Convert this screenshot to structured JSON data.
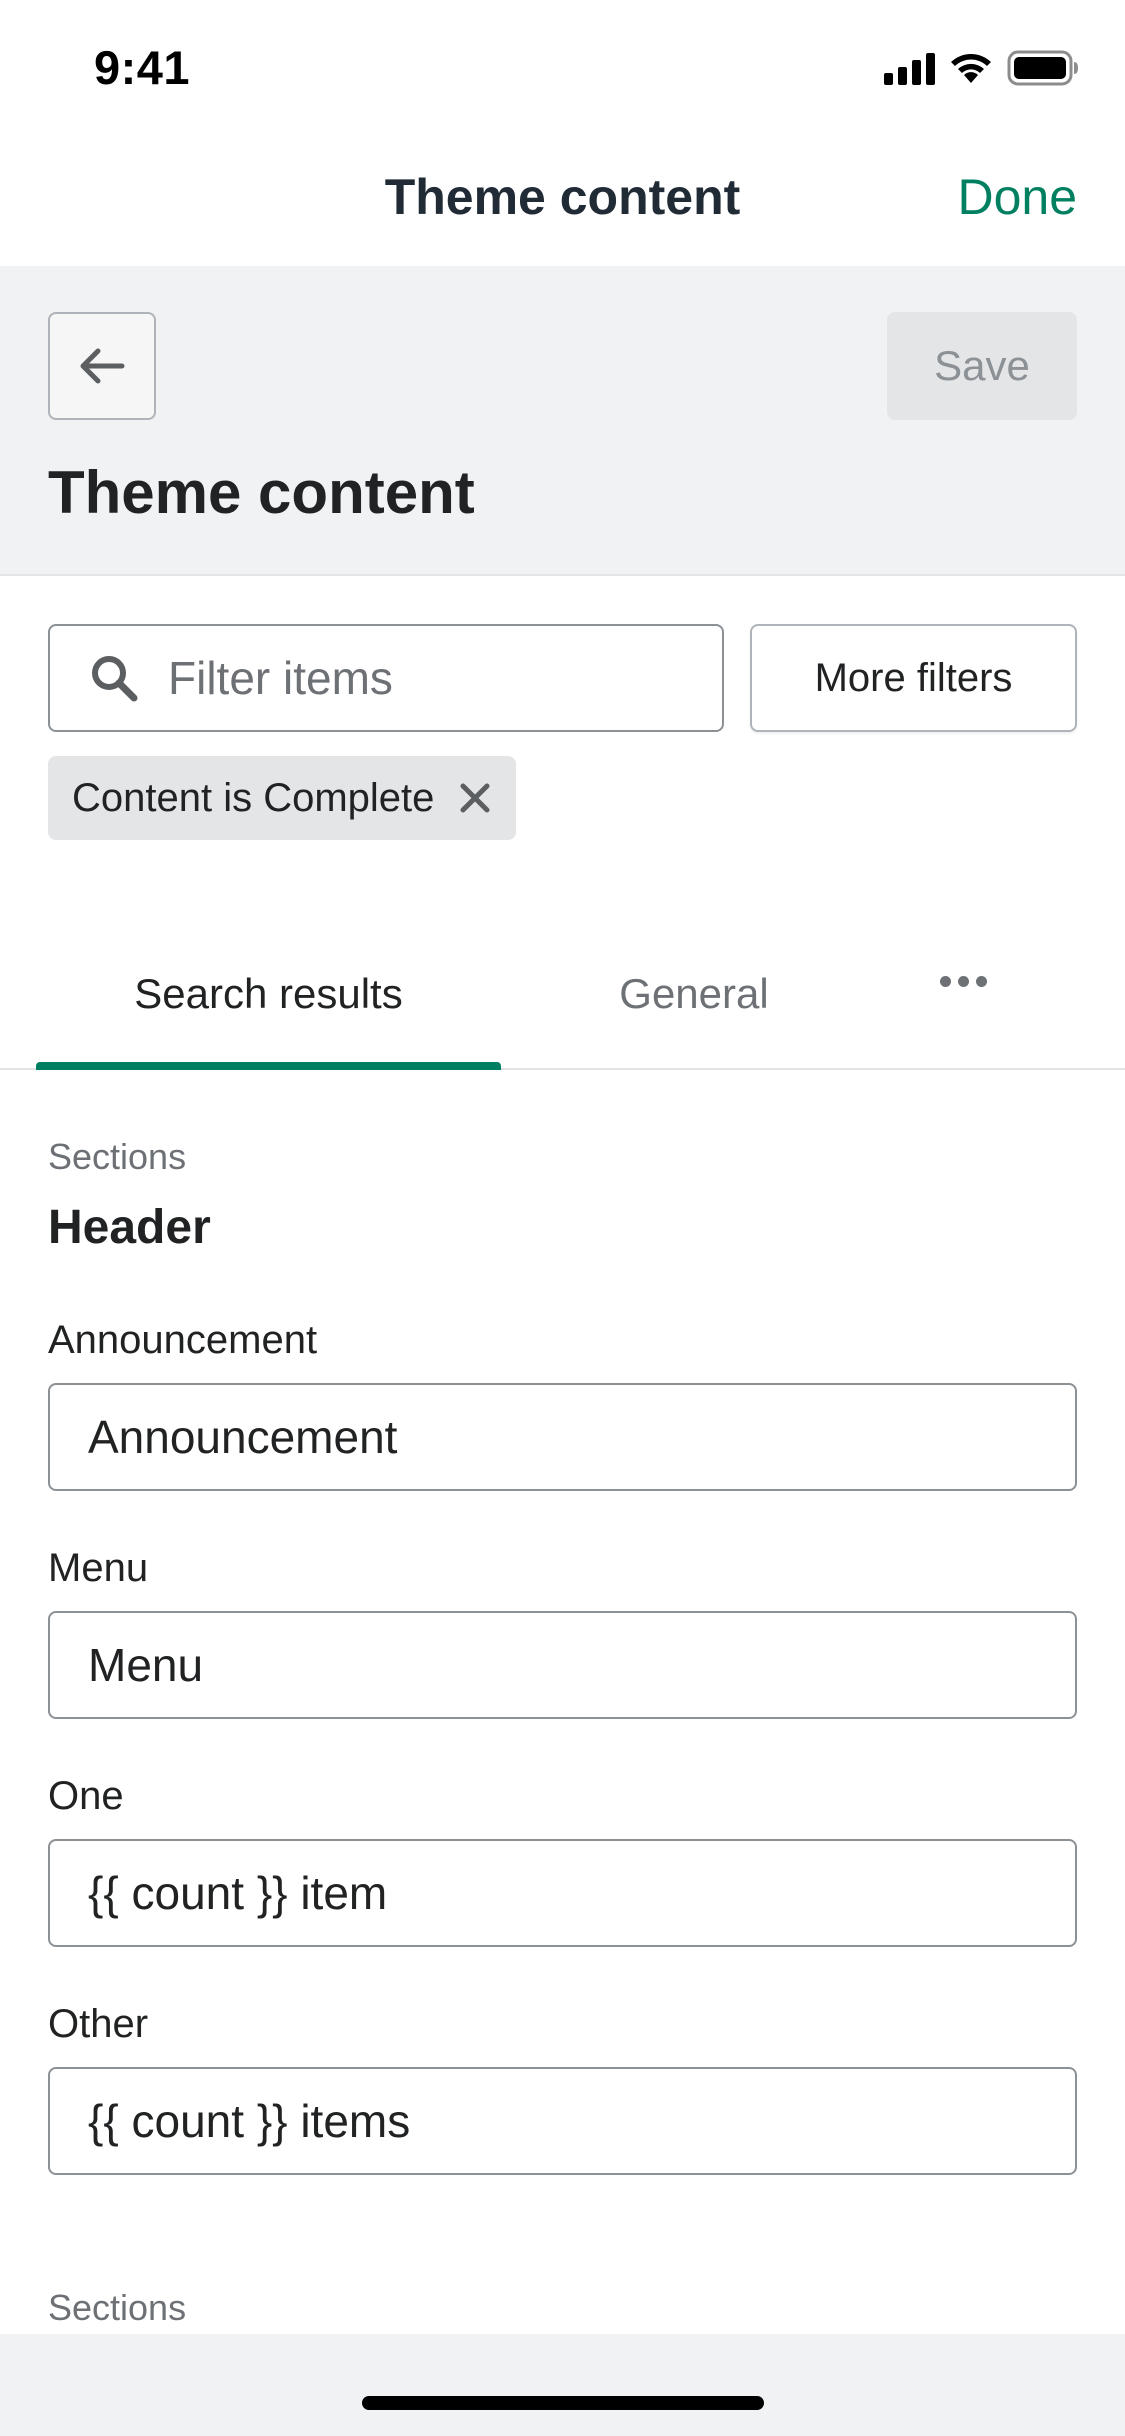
{
  "status_bar": {
    "time": "9:41"
  },
  "navbar": {
    "title": "Theme content",
    "done_label": "Done"
  },
  "page_header": {
    "save_label": "Save",
    "title": "Theme content"
  },
  "filters": {
    "search_placeholder": "Filter items",
    "more_filters_label": "More filters",
    "applied_tag": "Content is Complete"
  },
  "tabs": [
    {
      "label": "Search results",
      "selected": true
    },
    {
      "label": "General",
      "selected": false
    }
  ],
  "content": {
    "section_label": "Sections",
    "section_heading": "Header",
    "fields": [
      {
        "label": "Announcement",
        "value": "Announcement"
      },
      {
        "label": "Menu",
        "value": "Menu"
      },
      {
        "label": "One",
        "value": "{{ count }} item"
      },
      {
        "label": "Other",
        "value": "{{ count }} items"
      }
    ],
    "next_section_label": "Sections"
  },
  "colors": {
    "accent": "#008060",
    "header_bg": "#f1f2f4",
    "text": "#202223",
    "subdued": "#6d7175"
  },
  "icons": [
    "signal-icon",
    "wifi-icon",
    "battery-icon",
    "arrow-left-icon",
    "search-icon",
    "close-icon",
    "more-horizontal-icon"
  ]
}
